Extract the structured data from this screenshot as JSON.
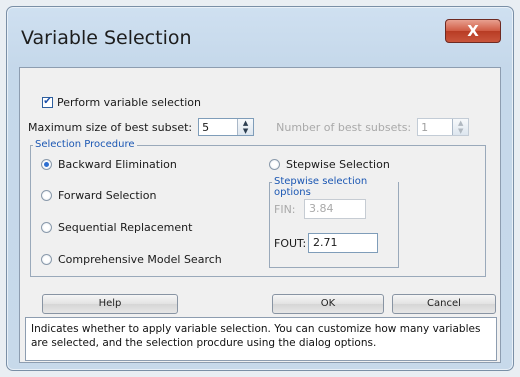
{
  "window": {
    "title": "Variable Selection",
    "close_glyph": "X"
  },
  "perform": {
    "label": "Perform variable selection",
    "checked": true
  },
  "max_subset": {
    "label": "Maximum size of best subset:",
    "value": "5"
  },
  "num_subsets": {
    "label": "Number of best subsets:",
    "value": "1"
  },
  "procedure": {
    "caption": "Selection Procedure",
    "options": [
      {
        "label": "Backward Elimination",
        "selected": true
      },
      {
        "label": "Forward Selection",
        "selected": false
      },
      {
        "label": "Sequential Replacement",
        "selected": false
      },
      {
        "label": "Comprehensive Model Search",
        "selected": false
      },
      {
        "label": "Stepwise Selection",
        "selected": false
      }
    ]
  },
  "stepwise": {
    "caption": "Stepwise selection options",
    "fin_label": "FIN:",
    "fin_value": "3.84",
    "fout_label": "FOUT:",
    "fout_value": "2.71"
  },
  "buttons": {
    "help": "Help",
    "ok": "OK",
    "cancel": "Cancel"
  },
  "description": "Indicates whether to apply variable selection. You can customize how many variables are selected, and the selection procdure using the dialog options."
}
